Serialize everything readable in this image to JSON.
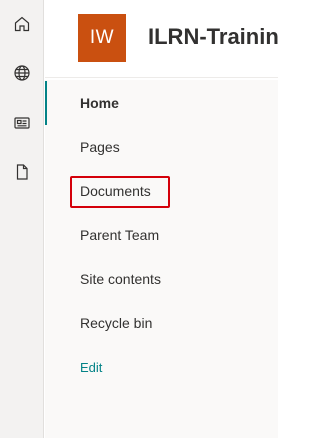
{
  "rail": {
    "icons": [
      "home-icon",
      "globe-icon",
      "news-icon",
      "document-icon"
    ]
  },
  "header": {
    "logo_initials": "IW",
    "logo_color": "#ca5010",
    "site_title": "ILRN-Trainin"
  },
  "nav": {
    "accent_color": "#038387",
    "items": [
      {
        "label": "Home",
        "active": true
      },
      {
        "label": "Pages"
      },
      {
        "label": "Documents",
        "highlighted": true
      },
      {
        "label": "Parent Team"
      },
      {
        "label": "Site contents"
      },
      {
        "label": "Recycle bin"
      }
    ],
    "edit_label": "Edit"
  },
  "highlight_color": "#d4000a"
}
